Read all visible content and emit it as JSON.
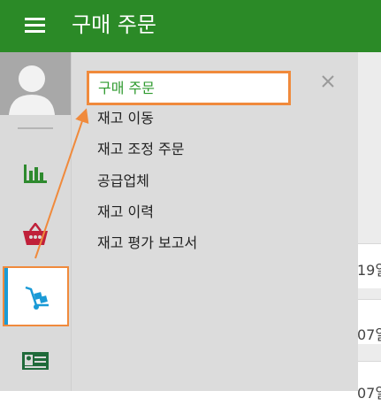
{
  "header": {
    "title": "구매 주문"
  },
  "menu": {
    "items": [
      "구매 주문",
      "재고 이동",
      "재고 조정 주문",
      "공급업체",
      "재고 이력",
      "재고 평가 보고서"
    ]
  },
  "table_partial": {
    "cells": [
      "19일",
      "07일",
      "07일"
    ]
  },
  "colors": {
    "header_green": "#2b8a27",
    "highlight_orange": "#f08a3c",
    "active_blue": "#1a9ad6"
  },
  "icons": {
    "menu": "hamburger-icon",
    "avatar": "user-avatar-icon",
    "reports": "bar-chart-icon",
    "sales": "basket-icon",
    "inventory": "hand-truck-icon",
    "contacts": "id-card-icon",
    "close": "close-icon"
  }
}
